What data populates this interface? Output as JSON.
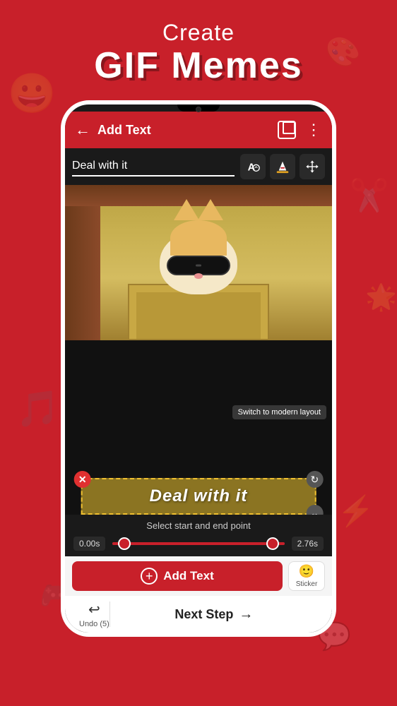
{
  "page": {
    "background_color": "#c8202a",
    "header": {
      "create_label": "Create",
      "gif_memes_label": "GIF Memes"
    },
    "phone": {
      "top_bar": {
        "back_icon": "←",
        "title": "Add Text",
        "more_icon": "⋮"
      },
      "text_input": {
        "value": "Deal with it",
        "placeholder": "Deal with it"
      },
      "text_overlay": {
        "content": "Deal with it"
      },
      "switch_layout_btn": "Switch to modern layout",
      "timeline": {
        "label": "Select start and end point",
        "start_time": "0.00s",
        "end_time": "2.76s"
      },
      "action_bar": {
        "add_text_label": "Add Text",
        "sticker_label": "Sticker"
      },
      "bottom_nav": {
        "undo_icon": "↩",
        "undo_label": "Undo (5)",
        "next_step_label": "Next Step",
        "next_arrow": "→"
      }
    }
  }
}
